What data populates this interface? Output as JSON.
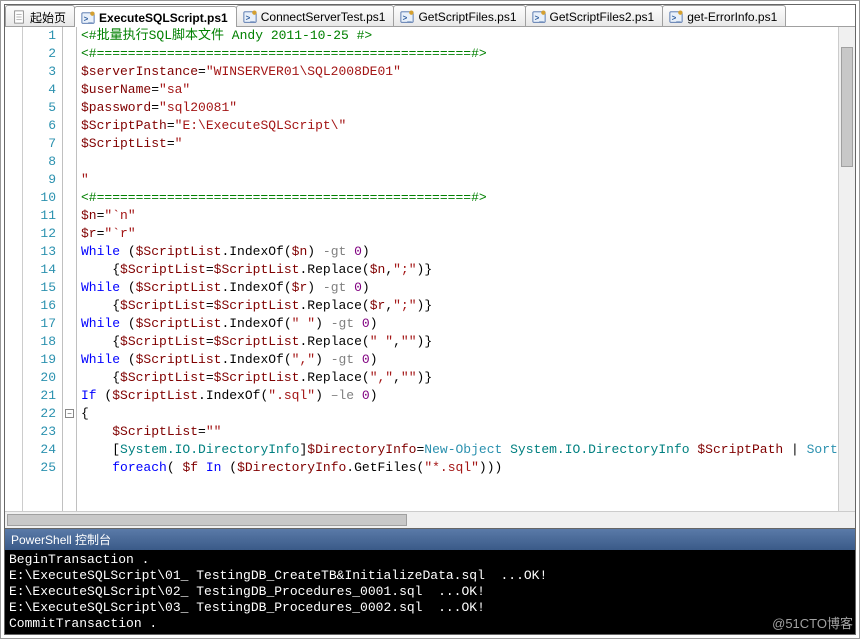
{
  "tabs": [
    {
      "label": "起始页",
      "icon": "page"
    },
    {
      "label": "ExecuteSQLScript.ps1",
      "icon": "ps"
    },
    {
      "label": "ConnectServerTest.ps1",
      "icon": "ps"
    },
    {
      "label": "GetScriptFiles.ps1",
      "icon": "ps"
    },
    {
      "label": "GetScriptFiles2.ps1",
      "icon": "ps"
    },
    {
      "label": "get-ErrorInfo.ps1",
      "icon": "ps"
    }
  ],
  "activeTab": 1,
  "code": {
    "lines": [
      {
        "n": 1,
        "h": "<span class='cgreen'>&lt;#批量执行SQL脚本文件 Andy 2011-10-25 #&gt;</span>"
      },
      {
        "n": 2,
        "h": "<span class='cgreen'>&lt;#================================================#&gt;</span>"
      },
      {
        "n": 3,
        "h": "<span class='cvar'>$serverInstance</span>=<span class='cstr'>\"WINSERVER01\\SQL2008DE01\"</span>"
      },
      {
        "n": 4,
        "h": "<span class='cvar'>$userName</span>=<span class='cstr'>\"sa\"</span>"
      },
      {
        "n": 5,
        "h": "<span class='cvar'>$password</span>=<span class='cstr'>\"sql20081\"</span>"
      },
      {
        "n": 6,
        "h": "<span class='cvar'>$ScriptPath</span>=<span class='cstr'>\"E:\\ExecuteSQLScript\\\"</span>"
      },
      {
        "n": 7,
        "h": "<span class='cvar'>$ScriptList</span>=<span class='cstr'>\"</span>"
      },
      {
        "n": 8,
        "h": ""
      },
      {
        "n": 9,
        "h": "<span class='cstr'>\"</span>"
      },
      {
        "n": 10,
        "h": "<span class='cgreen'>&lt;#================================================#&gt;</span>"
      },
      {
        "n": 11,
        "h": "<span class='cvar'>$n</span>=<span class='cstr'>\"`n\"</span>"
      },
      {
        "n": 12,
        "h": "<span class='cvar'>$r</span>=<span class='cstr'>\"`r\"</span>"
      },
      {
        "n": 13,
        "h": "<span class='ckey'>While</span> (<span class='cvar'>$ScriptList</span>.IndexOf(<span class='cvar'>$n</span>) <span class='cgray'>-gt</span> <span class='cnum'>0</span>)"
      },
      {
        "n": 14,
        "h": "    {<span class='cvar'>$ScriptList</span>=<span class='cvar'>$ScriptList</span>.Replace(<span class='cvar'>$n</span>,<span class='cstr'>\";\"</span>)}"
      },
      {
        "n": 15,
        "h": "<span class='ckey'>While</span> (<span class='cvar'>$ScriptList</span>.IndexOf(<span class='cvar'>$r</span>) <span class='cgray'>-gt</span> <span class='cnum'>0</span>)"
      },
      {
        "n": 16,
        "h": "    {<span class='cvar'>$ScriptList</span>=<span class='cvar'>$ScriptList</span>.Replace(<span class='cvar'>$r</span>,<span class='cstr'>\";\"</span>)}"
      },
      {
        "n": 17,
        "h": "<span class='ckey'>While</span> (<span class='cvar'>$ScriptList</span>.IndexOf(<span class='cstr'>\" \"</span>) <span class='cgray'>-gt</span> <span class='cnum'>0</span>)"
      },
      {
        "n": 18,
        "h": "    {<span class='cvar'>$ScriptList</span>=<span class='cvar'>$ScriptList</span>.Replace(<span class='cstr'>\" \"</span>,<span class='cstr'>\"\"</span>)}"
      },
      {
        "n": 19,
        "h": "<span class='ckey'>While</span> (<span class='cvar'>$ScriptList</span>.IndexOf(<span class='cstr'>\",\"</span>) <span class='cgray'>-gt</span> <span class='cnum'>0</span>)"
      },
      {
        "n": 20,
        "h": "    {<span class='cvar'>$ScriptList</span>=<span class='cvar'>$ScriptList</span>.Replace(<span class='cstr'>\",\"</span>,<span class='cstr'>\"\"</span>)}"
      },
      {
        "n": 21,
        "h": "<span class='ckey'>If</span> (<span class='cvar'>$ScriptList</span>.IndexOf(<span class='cstr'>\".sql\"</span>) <span class='cgray'>–le</span> <span class='cnum'>0</span>)"
      },
      {
        "n": 22,
        "h": "{",
        "fold": true
      },
      {
        "n": 23,
        "h": "    <span class='cvar'>$ScriptList</span>=<span class='cstr'>\"\"</span>"
      },
      {
        "n": 24,
        "h": "    [<span class='ctype'>System.IO.DirectoryInfo</span>]<span class='cvar'>$DirectoryInfo</span>=<span class='cteal'>New-Object</span> <span class='ctype'>System.IO.DirectoryInfo</span> <span class='cvar'>$ScriptPath</span> | <span class='cteal'>Sort-Object</span>"
      },
      {
        "n": 25,
        "h": "    <span class='ckey'>foreach</span>( <span class='cvar'>$f</span> <span class='ckey'>In</span> (<span class='cvar'>$DirectoryInfo</span>.GetFiles(<span class='cstr'>\"*.sql\"</span>)))"
      }
    ]
  },
  "console": {
    "title": "PowerShell 控制台",
    "lines": [
      "BeginTransaction .",
      "E:\\ExecuteSQLScript\\01_ TestingDB_CreateTB&InitializeData.sql  ...OK!",
      "E:\\ExecuteSQLScript\\02_ TestingDB_Procedures_0001.sql  ...OK!",
      "E:\\ExecuteSQLScript\\03_ TestingDB_Procedures_0002.sql  ...OK!",
      "CommitTransaction ."
    ]
  },
  "watermark": "@51CTO博客"
}
